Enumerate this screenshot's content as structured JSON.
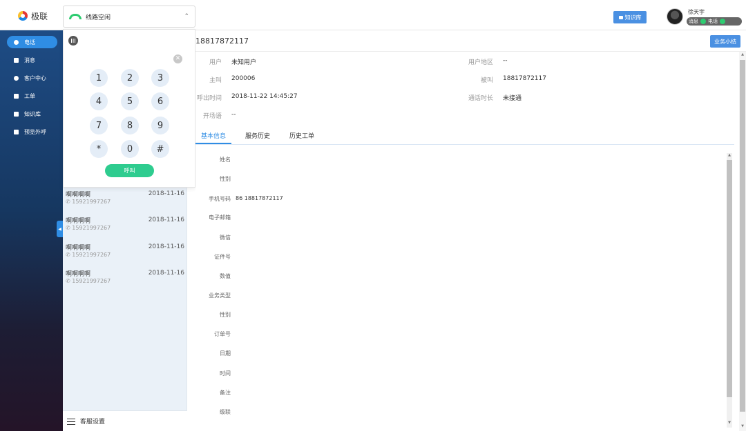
{
  "header": {
    "logo_text": "极联",
    "line_status": "线路空闲",
    "knowledge_button": "知识库",
    "user_name": "徐天宇",
    "status_message_label": "消息",
    "status_phone_label": "电话"
  },
  "sidebar": {
    "items": [
      {
        "label": "电话",
        "icon": "phone-icon"
      },
      {
        "label": "消息",
        "icon": "message-icon"
      },
      {
        "label": "客户中心",
        "icon": "user-icon"
      },
      {
        "label": "工单",
        "icon": "ticket-icon"
      },
      {
        "label": "知识库",
        "icon": "book-icon"
      },
      {
        "label": "预览外呼",
        "icon": "outbound-icon"
      }
    ]
  },
  "dialpad": {
    "keys": [
      "1",
      "2",
      "3",
      "4",
      "5",
      "6",
      "7",
      "8",
      "9",
      "*",
      "0",
      "#"
    ],
    "call_label": "呼叫",
    "clear_glyph": "✕"
  },
  "records": [
    {
      "name": "啊啊啊啊",
      "phone": "15921997267",
      "date": "2018-11-16"
    },
    {
      "name": "啊啊啊啊",
      "phone": "15921997267",
      "date": "2018-11-16"
    },
    {
      "name": "啊啊啊啊",
      "phone": "15921997267",
      "date": "2018-11-16"
    },
    {
      "name": "啊啊啊啊",
      "phone": "15921997267",
      "date": "2018-11-16"
    }
  ],
  "settings_label": "客服设置",
  "main": {
    "title_number": "18817872117",
    "summary_button": "业务小结",
    "info": {
      "user_label": "用户",
      "user_value": "未知用户",
      "region_label": "用户地区",
      "region_value": "--",
      "caller_label": "主叫",
      "caller_value": "200006",
      "callee_label": "被叫",
      "callee_value": "18817872117",
      "time_label": "呼出时间",
      "time_value": "2018-11-22 14:45:27",
      "duration_label": "通话时长",
      "duration_value": "未接通",
      "opening_label": "开场语",
      "opening_value": "--"
    },
    "tabs": [
      "基本信息",
      "服务历史",
      "历史工单"
    ],
    "fields": [
      {
        "label": "姓名",
        "value": ""
      },
      {
        "label": "性别",
        "value": ""
      },
      {
        "label": "手机号码",
        "value": "86 18817872117"
      },
      {
        "label": "电子邮箱",
        "value": ""
      },
      {
        "label": "微信",
        "value": ""
      },
      {
        "label": "证件号",
        "value": ""
      },
      {
        "label": "数值",
        "value": ""
      },
      {
        "label": "业务类型",
        "value": ""
      },
      {
        "label": "性别",
        "value": ""
      },
      {
        "label": "订单号",
        "value": ""
      },
      {
        "label": "日期",
        "value": ""
      },
      {
        "label": "时间",
        "value": ""
      },
      {
        "label": "备注",
        "value": ""
      },
      {
        "label": "级联",
        "value": ""
      }
    ]
  },
  "colors": {
    "accent": "#2f8de4",
    "call_green": "#2ecc8f",
    "sidebar_top": "#1e4c85",
    "sidebar_bottom": "#241428"
  }
}
